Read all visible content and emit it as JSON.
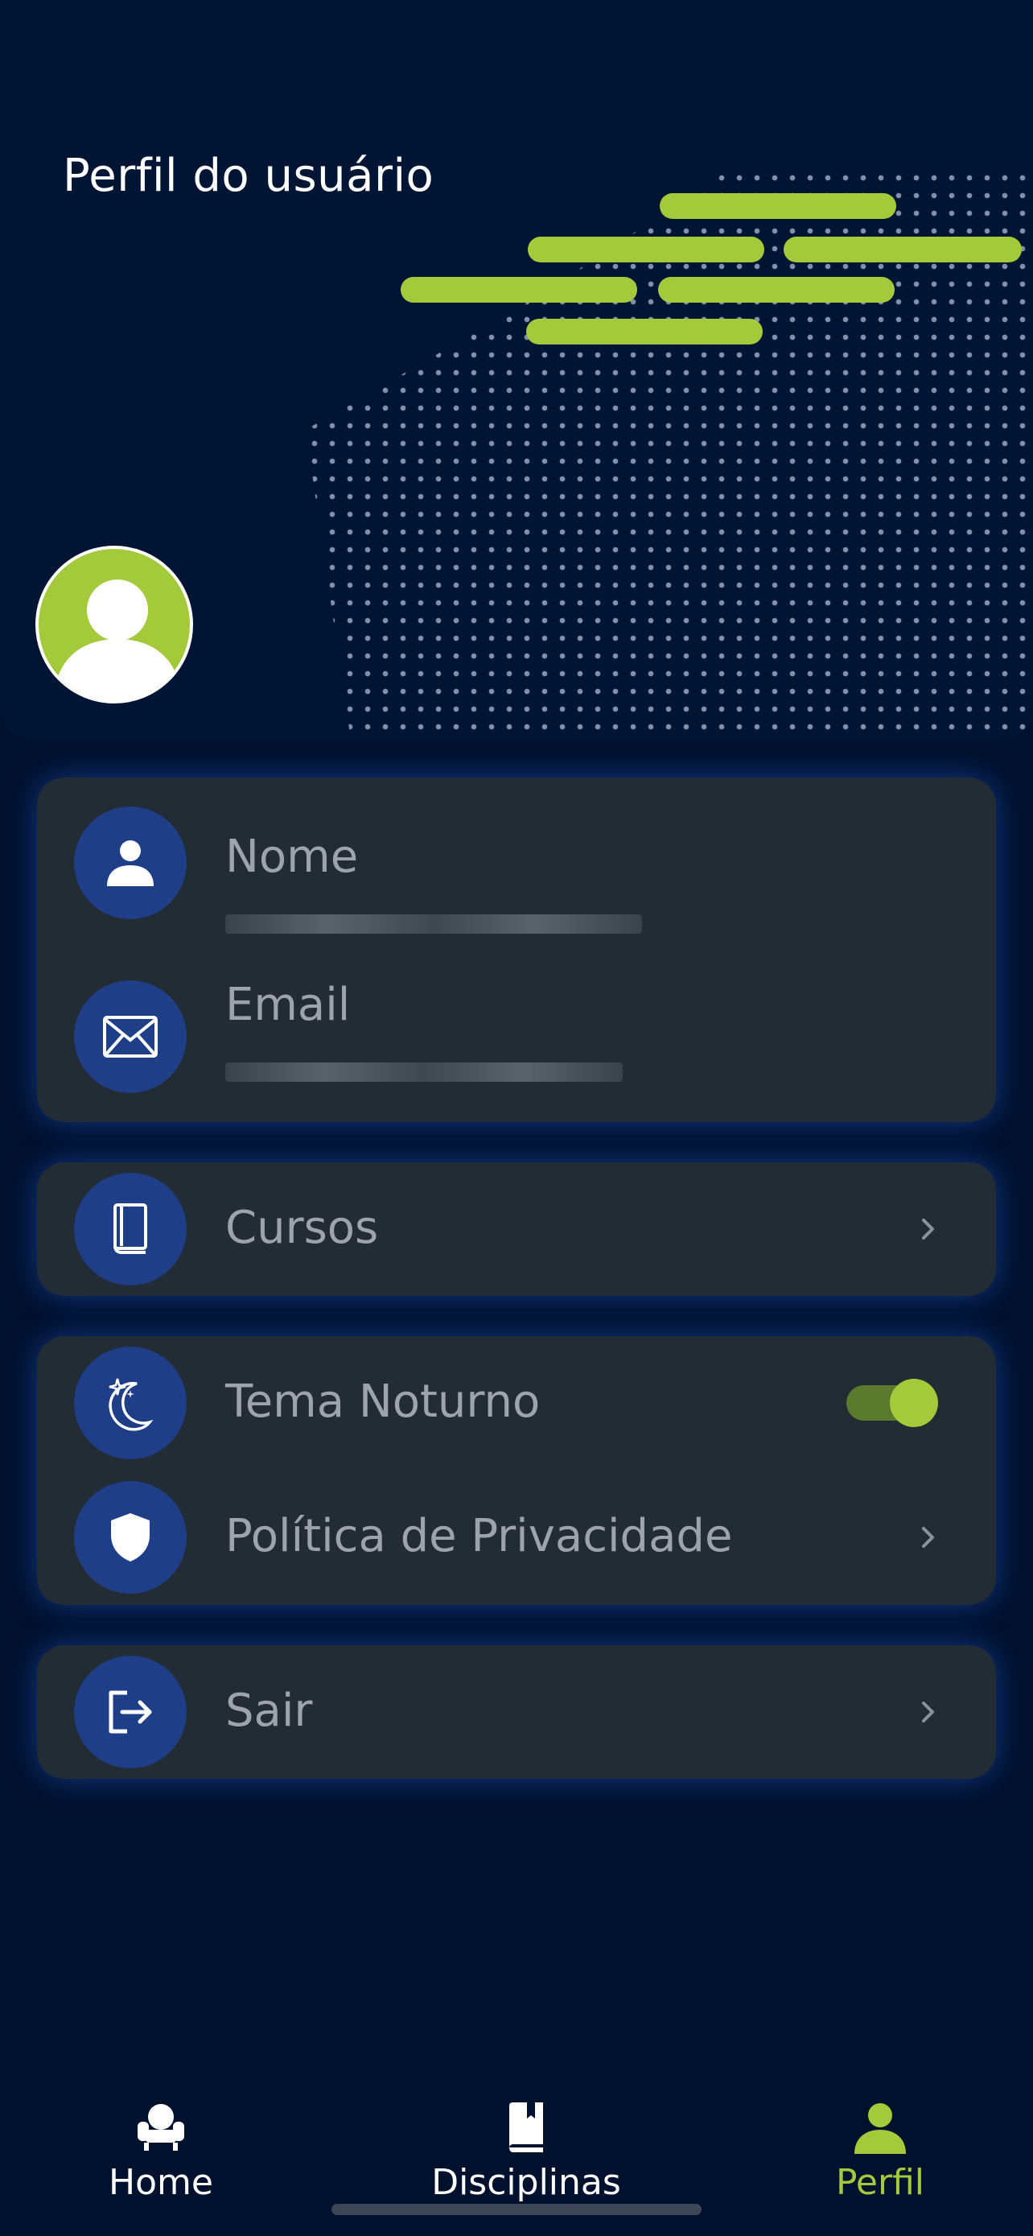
{
  "header": {
    "title": "Perfil do usuário"
  },
  "profile": {
    "name_label": "Nome",
    "name_value": "",
    "email_label": "Email",
    "email_value": ""
  },
  "menu": {
    "courses_label": "Cursos",
    "dark_theme_label": "Tema Noturno",
    "dark_theme_enabled": true,
    "privacy_label": "Política de Privacidade",
    "logout_label": "Sair"
  },
  "bottom_nav": {
    "items": [
      {
        "label": "Home",
        "icon": "armchair-icon",
        "active": false
      },
      {
        "label": "Disciplinas",
        "icon": "book-icon",
        "active": false
      },
      {
        "label": "Perfil",
        "icon": "person-icon",
        "active": true
      }
    ]
  },
  "colors": {
    "background": "#00112e",
    "card": "#232b34",
    "accent": "#a4c93b",
    "icon_circle": "#1e3f87",
    "muted_text": "#9ca3ad"
  }
}
